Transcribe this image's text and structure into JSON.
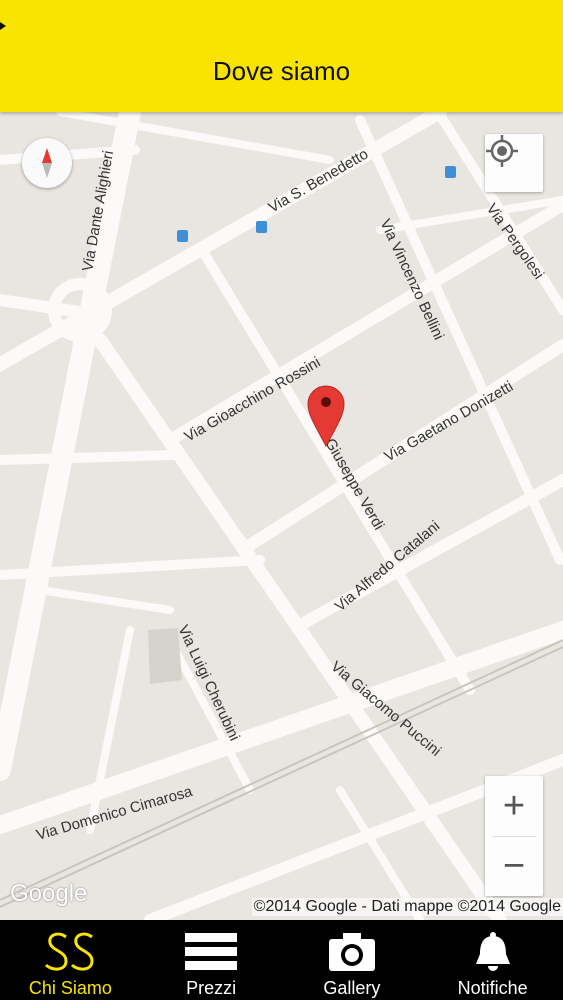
{
  "header": {
    "title": "Dove siamo"
  },
  "map": {
    "streets": {
      "dante": "Via Dante Alighieri",
      "benedetto": "Via S. Benedetto",
      "bellini": "Via Vincenzo Bellini",
      "pergolesi": "Via Pergolesi",
      "rossini": "Via Gioacchino Rossini",
      "donizetti": "Via Gaetano Donizetti",
      "verdi": "Via Giuseppe Verdi",
      "catalani": "Via Alfredo Catalani",
      "cherubini": "Via Luigi Cherubini",
      "puccini": "Via Giacomo Puccini",
      "cimarosa": "Via Domenico Cimarosa"
    },
    "zoom_in": "+",
    "zoom_out": "−",
    "logo": "Google",
    "attribution": "©2014 Google - Dati mappe ©2014 Google",
    "colors": {
      "marker": "#e53a34",
      "road": "#fbfaf8",
      "land": "#e9e6e1",
      "transit": "#3f8fd8"
    }
  },
  "nav": {
    "tabs": [
      {
        "label": "Chi Siamo",
        "icon": "logo-ss-icon",
        "active": true
      },
      {
        "label": "Prezzi",
        "icon": "menu-lines-icon",
        "active": false
      },
      {
        "label": "Gallery",
        "icon": "camera-icon",
        "active": false
      },
      {
        "label": "Notifiche",
        "icon": "bell-icon",
        "active": false
      }
    ]
  },
  "colors": {
    "accent": "#f8e301",
    "nav_bg": "#000000"
  }
}
